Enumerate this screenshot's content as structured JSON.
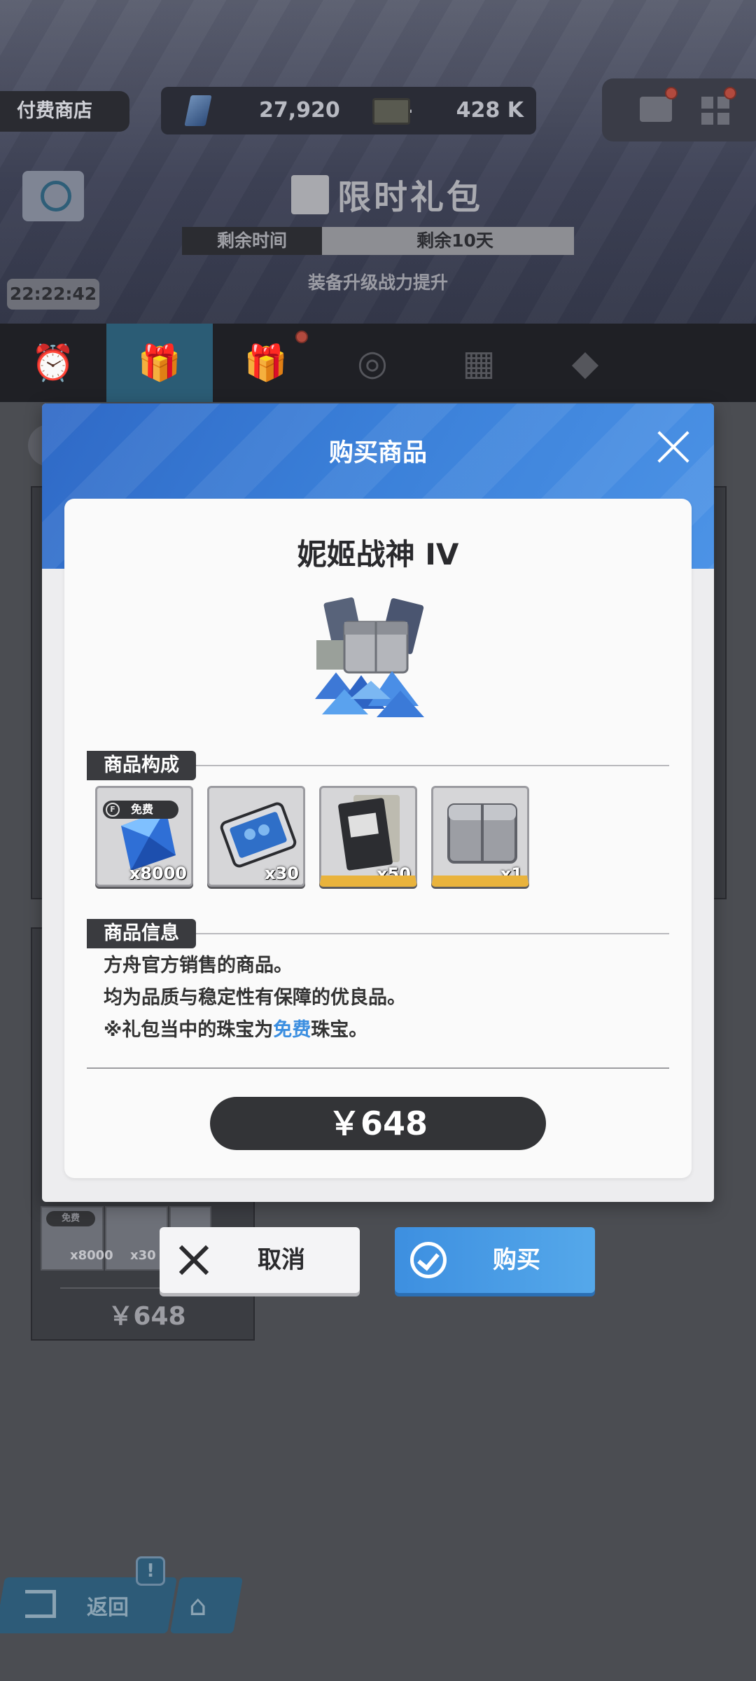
{
  "header": {
    "shop_label": "付费商店",
    "gem_amount": "27,920",
    "gem_plus": "+",
    "ticket_amount": "428 K"
  },
  "pack": {
    "title": "限时礼包",
    "remaining_label": "剩余时间",
    "remaining_value": "剩余10天",
    "subtitle": "装备升级战力提升",
    "timer": "22:22:42"
  },
  "tabs": [
    {
      "name": "alarm-clock-icon",
      "glyph": "⏰",
      "active": false
    },
    {
      "name": "gift-pack-icon",
      "glyph": "🎁",
      "active": true
    },
    {
      "name": "gift-icon",
      "glyph": "🎁",
      "active": false
    },
    {
      "name": "target-icon",
      "glyph": "◎",
      "active": false
    },
    {
      "name": "calendar-icon",
      "glyph": "▦",
      "active": false
    },
    {
      "name": "diamond-icon",
      "glyph": "◆",
      "active": false
    }
  ],
  "background_card": {
    "free_badge": "免费",
    "thumb_qty_1": "x8000",
    "thumb_qty_2": "x30",
    "price": "￥648"
  },
  "modal": {
    "title": "购买商品",
    "product_name": "妮姬战神 IV",
    "composition_label": "商品构成",
    "info_label": "商品信息",
    "items": [
      {
        "name": "gem-item",
        "qty": "x8000",
        "free_badge": "免费",
        "free_badge_icon": "F"
      },
      {
        "name": "card-item",
        "qty": "x30"
      },
      {
        "name": "book-item",
        "qty": "x50"
      },
      {
        "name": "box-item",
        "qty": "x1"
      }
    ],
    "info_lines": [
      "方舟官方销售的商品。",
      "均为品质与稳定性有保障的优良品。"
    ],
    "info_line3_prefix": "※礼包当中的珠宝为",
    "info_line3_highlight": "免费",
    "info_line3_suffix": "珠宝。",
    "price": "￥648"
  },
  "actions": {
    "cancel_label": "取消",
    "buy_label": "购买"
  },
  "footer": {
    "back_label": "返回",
    "notice_badge": "!"
  },
  "colors": {
    "accent_blue": "#3b8ee0",
    "modal_header_blue": "#3a7fd8",
    "gold": "#e9b33c",
    "notification_red": "#b24a3e"
  }
}
